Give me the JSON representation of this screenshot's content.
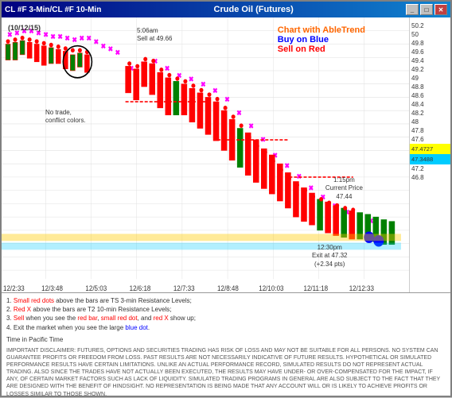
{
  "window": {
    "title_left": "CL #F 3-Min/CL #F 10-Min",
    "title_center": "Crude Oil (Futures)",
    "controls": [
      "_",
      "□",
      "✕"
    ]
  },
  "chart": {
    "date_label": "(10/12/15)",
    "annotation_sell": "5:06am\nSell at 49.66",
    "annotation_no_trade": "No trade,\nconflict colors.",
    "annotation_current_price": "1:15pm\nCurrent Price\n47.44",
    "annotation_exit": "12:30pm\nExit at 47.32\n(+2.34 pts)",
    "legend_title": "Chart with AbleTrend",
    "legend_buy": "Buy on Blue",
    "legend_sell": "Sell on Red",
    "y_axis": {
      "labels": [
        "50.2",
        "50",
        "49.8",
        "49.6",
        "49.4",
        "49.2",
        "49",
        "48.8",
        "48.6",
        "48.4",
        "48.2",
        "48",
        "47.8",
        "47.6",
        "47.4727",
        "47.3488",
        "47.2",
        "46.8"
      ],
      "highlight1": "47.4727",
      "highlight2": "47.3488"
    },
    "x_axis": {
      "labels": [
        "12/2:33",
        "12/3:48",
        "12/5:03",
        "12/6:18",
        "12/7:33",
        "12/8:48",
        "12/10:03",
        "12/11:18",
        "12/12:33"
      ]
    }
  },
  "notes": {
    "item1": "1. Small red dots above the bars are TS 3-min Resistance Levels;",
    "item2": "2. Red X above the bars are T2 10-min Resistance Levels;",
    "item3": "3. Sell when you see the red bar, small red dot, and red X show up;",
    "item4": "4. Exit the market when you see the large blue dot.",
    "time_note": "Time in Pacific Time"
  },
  "disclaimer": "IMPORTANT DISCLAIMER: FUTURES, OPTIONS AND SECURITIES TRADING HAS RISK OF LOSS AND MAY NOT BE SUITABLE FOR ALL PERSONS. NO SYSTEM CAN GUARANTEE PROFITS OR FREEDOM FROM LOSS. PAST RESULTS ARE NOT NECESSARILY INDICATIVE OF FUTURE RESULTS. HYPOTHETICAL OR SIMULATED PERFORMANCE RESULTS HAVE CERTAIN LIMITATIONS. UNLIKE AN ACTUAL PERFORMANCE RECORD, SIMULATED RESULTS DO NOT REPRESENT ACTUAL TRADING. ALSO SINCE THE TRADES HAVE NOT ACTUALLY BEEN EXECUTED, THE RESULTS MAY HAVE UNDER- OR OVER-COMPENSATED FOR THE IMPACT, IF ANY, OF CERTAIN MARKET FACTORS SUCH AS LACK OF LIQUIDITY. SIMULATED TRADING PROGRAMS IN GENERAL ARE ALSO SUBJECT TO THE FACT THAT THEY ARE DESIGNED WITH THE BENEFIT OF HINDSIGHT. NO REPRESENTATION IS BEING MADE THAT ANY ACCOUNT WILL OR IS LIKELY TO ACHIEVE PROFITS OR LOSSES SIMILAR TO THOSE SHOWN."
}
